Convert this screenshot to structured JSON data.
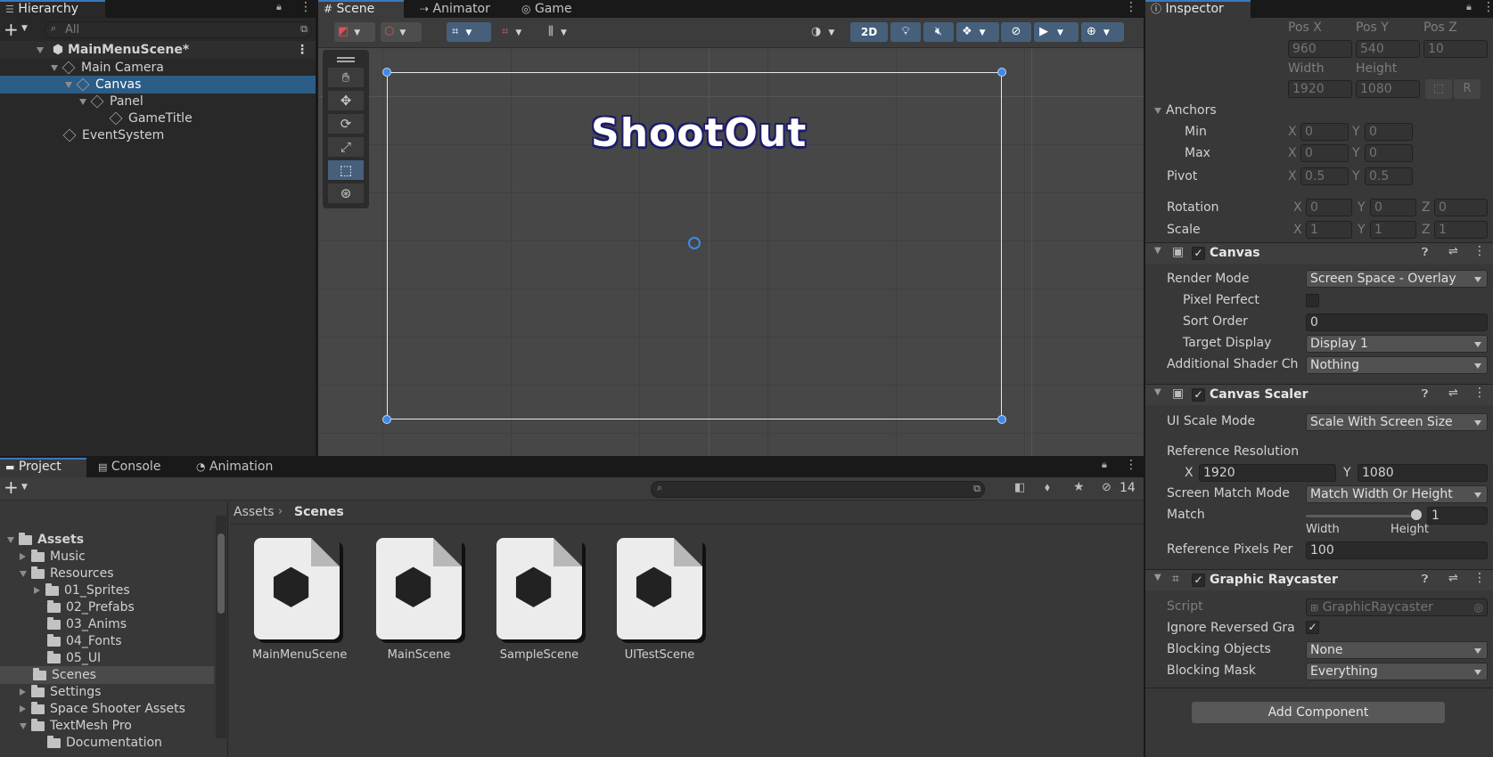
{
  "hierarchy": {
    "tab_label": "Hierarchy",
    "search_placeholder": "All",
    "items": [
      {
        "label": "MainMenuScene*"
      },
      {
        "label": "Main Camera"
      },
      {
        "label": "Canvas"
      },
      {
        "label": "Panel"
      },
      {
        "label": "GameTitle"
      },
      {
        "label": "EventSystem"
      }
    ]
  },
  "scene": {
    "tabs": [
      "Scene",
      "Animator",
      "Game"
    ],
    "mode_2d": "2D",
    "title_text": "ShootOut"
  },
  "inspector": {
    "tab_label": "Inspector",
    "rect": {
      "posx_label": "Pos X",
      "posy_label": "Pos Y",
      "posz_label": "Pos Z",
      "posx": "960",
      "posy": "540",
      "posz": "10",
      "width_label": "Width",
      "height_label": "Height",
      "width": "1920",
      "height": "1080"
    },
    "anchors": {
      "label": "Anchors",
      "min_label": "Min",
      "max_label": "Max",
      "min_x": "0",
      "min_y": "0",
      "max_x": "0",
      "max_y": "0"
    },
    "pivot": {
      "label": "Pivot",
      "x": "0.5",
      "y": "0.5"
    },
    "rotation": {
      "label": "Rotation",
      "x": "0",
      "y": "0",
      "z": "0"
    },
    "scale": {
      "label": "Scale",
      "x": "1",
      "y": "1",
      "z": "1"
    },
    "axis": {
      "x": "X",
      "y": "Y",
      "z": "Z"
    },
    "canvas": {
      "title": "Canvas",
      "render_mode_label": "Render Mode",
      "render_mode": "Screen Space - Overlay",
      "pixel_perfect_label": "Pixel Perfect",
      "sort_order_label": "Sort Order",
      "sort_order": "0",
      "target_display_label": "Target Display",
      "target_display": "Display 1",
      "shader_label": "Additional Shader Ch",
      "shader": "Nothing"
    },
    "canvas_scaler": {
      "title": "Canvas Scaler",
      "ui_scale_label": "UI Scale Mode",
      "ui_scale": "Scale With Screen Size",
      "ref_res_label": "Reference Resolution",
      "ref_x": "1920",
      "ref_y": "1080",
      "match_mode_label": "Screen Match Mode",
      "match_mode": "Match Width Or Height",
      "match_label": "Match",
      "match_value": "1",
      "match_fraction": 1.0,
      "width_label": "Width",
      "height_label": "Height",
      "ppu_label": "Reference Pixels Per",
      "ppu": "100"
    },
    "raycaster": {
      "title": "Graphic Raycaster",
      "script_label": "Script",
      "script": "GraphicRaycaster",
      "ignore_label": "Ignore Reversed Gra",
      "blocking_objects_label": "Blocking Objects",
      "blocking_objects": "None",
      "blocking_mask_label": "Blocking Mask",
      "blocking_mask": "Everything"
    },
    "add_component": "Add Component"
  },
  "project": {
    "tabs": [
      "Project",
      "Console",
      "Animation"
    ],
    "hidden_count": "14",
    "breadcrumb": [
      "Assets",
      "Scenes"
    ],
    "tree": [
      {
        "label": "Assets"
      },
      {
        "label": "Music"
      },
      {
        "label": "Resources"
      },
      {
        "label": "01_Sprites"
      },
      {
        "label": "02_Prefabs"
      },
      {
        "label": "03_Anims"
      },
      {
        "label": "04_Fonts"
      },
      {
        "label": "05_UI"
      },
      {
        "label": "Scenes"
      },
      {
        "label": "Settings"
      },
      {
        "label": "Space Shooter Assets"
      },
      {
        "label": "TextMesh Pro"
      },
      {
        "label": "Documentation"
      }
    ],
    "assets": [
      "MainMenuScene",
      "MainScene",
      "SampleScene",
      "UITestScene"
    ]
  }
}
